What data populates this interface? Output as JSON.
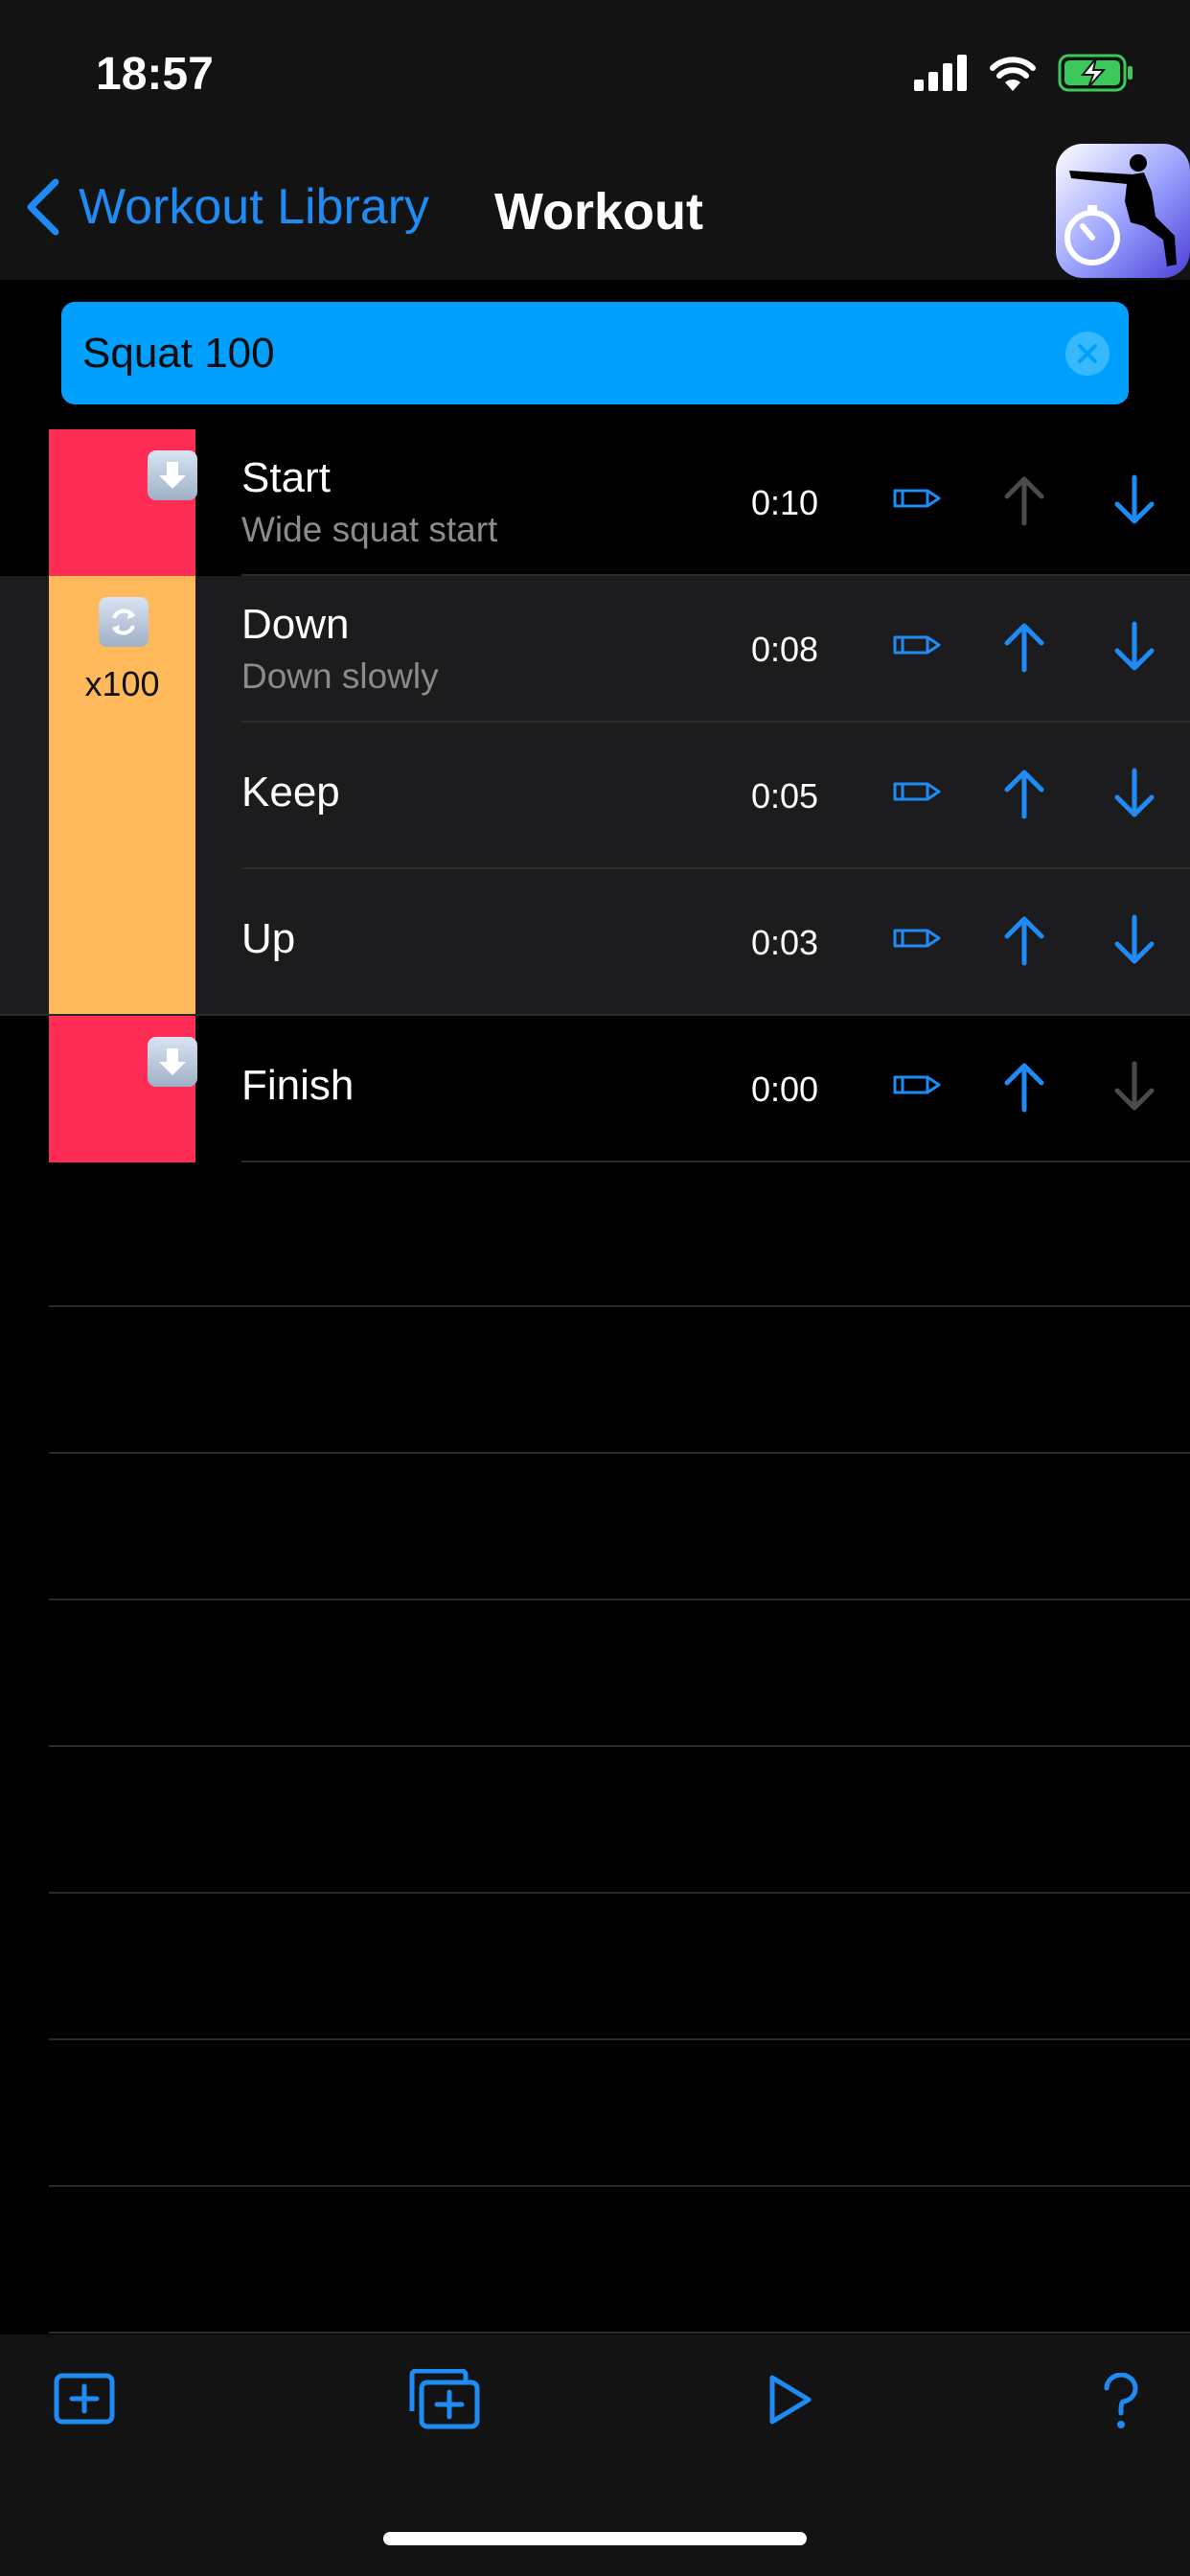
{
  "status_bar": {
    "time": "18:57"
  },
  "nav": {
    "back_label": "Workout Library",
    "title": "Workout"
  },
  "search": {
    "value": "Squat 100"
  },
  "steps": [
    {
      "name": "Start",
      "subtitle": "Wide squat start",
      "duration": "0:10",
      "up_enabled": false,
      "down_enabled": true,
      "group": "single"
    },
    {
      "name": "Down",
      "subtitle": "Down slowly",
      "duration": "0:08",
      "up_enabled": true,
      "down_enabled": true,
      "group": "repeat"
    },
    {
      "name": "Keep",
      "subtitle": "",
      "duration": "0:05",
      "up_enabled": true,
      "down_enabled": true,
      "group": "repeat"
    },
    {
      "name": "Up",
      "subtitle": "",
      "duration": "0:03",
      "up_enabled": true,
      "down_enabled": true,
      "group": "repeat"
    },
    {
      "name": "Finish",
      "subtitle": "",
      "duration": "0:00",
      "up_enabled": true,
      "down_enabled": false,
      "group": "single"
    }
  ],
  "repeat_group": {
    "label": "x100"
  },
  "toolbar": {
    "icons": [
      "add-step-icon",
      "add-group-icon",
      "play-icon",
      "help-icon"
    ]
  },
  "colors": {
    "accent": "#1e8cf4",
    "single_step": "#ff2d55",
    "repeat_group": "#ffb95a",
    "search_bg": "#00a0ff"
  }
}
